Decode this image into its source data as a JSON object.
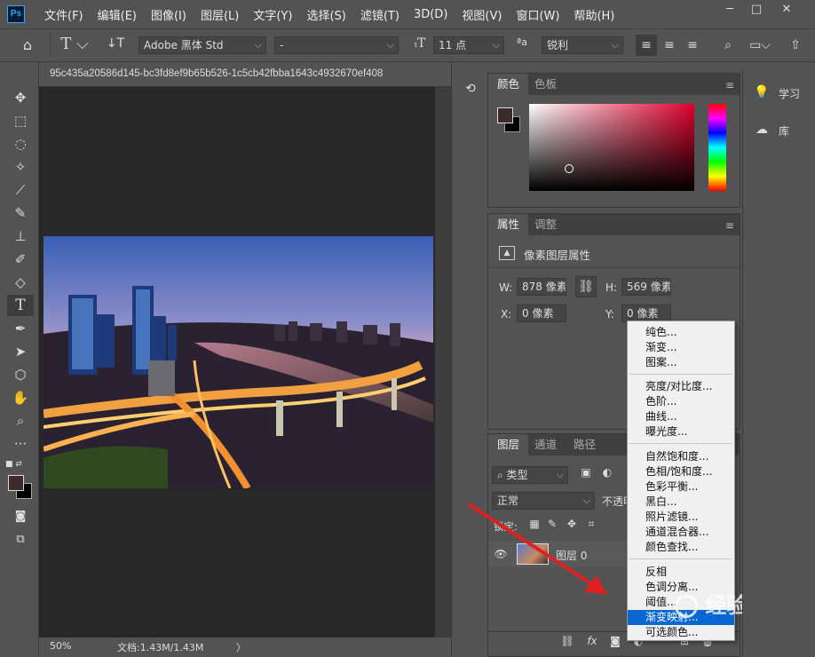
{
  "menubar": {
    "items": [
      "文件(F)",
      "编辑(E)",
      "图像(I)",
      "图层(L)",
      "文字(Y)",
      "选择(S)",
      "滤镜(T)",
      "3D(D)",
      "视图(V)",
      "窗口(W)",
      "帮助(H)"
    ]
  },
  "app": {
    "logo": "Ps"
  },
  "options": {
    "font_family": "Adobe 黑体 Std",
    "font_style": "-",
    "font_size": "11 点",
    "antialias": "锐利",
    "aa_label": "ªa"
  },
  "document": {
    "tab_title": "95c435a20586d145-bc3fd8ef9b65b526-1c5cb42fbba1643c4932670ef408",
    "zoom": "50%",
    "doc_info": "文档:1.43M/1.43M",
    "status_arrow": "〉"
  },
  "color_panel": {
    "tabs": [
      "颜色",
      "色板"
    ],
    "foreground": "#3a2a2a",
    "background": "#000000"
  },
  "properties_panel": {
    "tabs": [
      "属性",
      "调整"
    ],
    "title": "像素图层属性",
    "w_label": "W:",
    "w_value": "878 像素",
    "h_label": "H:",
    "h_value": "569 像素",
    "x_label": "X:",
    "x_value": "0 像素",
    "y_label": "Y:",
    "y_value": "0 像素"
  },
  "layers_panel": {
    "tabs": [
      "图层",
      "通道",
      "路径"
    ],
    "filter_kind": "类型",
    "blend_mode": "正常",
    "opacity_label": "不透明",
    "lock_label": "锁定:",
    "layer_name": "图层 0"
  },
  "right_panel": {
    "items": [
      "学习",
      "库"
    ]
  },
  "adjust_menu": {
    "group1": [
      "纯色...",
      "渐变...",
      "图案..."
    ],
    "group2": [
      "亮度/对比度...",
      "色阶...",
      "曲线...",
      "曝光度..."
    ],
    "group3": [
      "自然饱和度...",
      "色相/饱和度...",
      "色彩平衡...",
      "黑白...",
      "照片滤镜...",
      "通道混合器...",
      "颜色查找..."
    ],
    "group4": [
      "反相",
      "色调分离...",
      "阈值...",
      "渐变映射...",
      "可选颜色..."
    ],
    "highlighted": "渐变映射..."
  },
  "watermark": {
    "text": "经验"
  }
}
